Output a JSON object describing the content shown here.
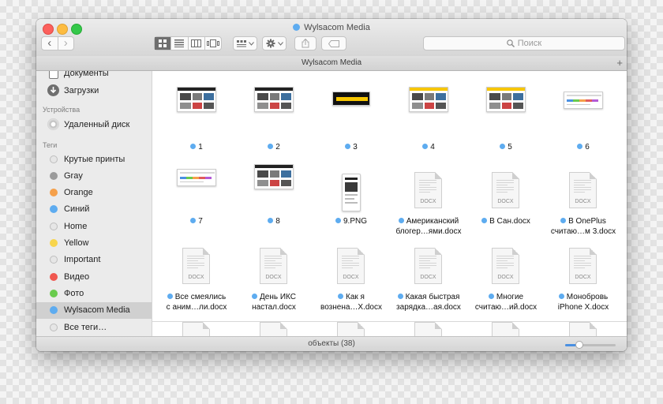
{
  "window": {
    "title": "Wylsacom Media",
    "title_dot_color": "#5eacf0",
    "path_title": "Wylsacom Media"
  },
  "toolbar": {
    "back_icon": "‹",
    "forward_icon": "›",
    "search_placeholder": "Поиск"
  },
  "sidebar": {
    "favorites": [
      {
        "label": "Документы",
        "icon": "documents-icon"
      },
      {
        "label": "Загрузки",
        "icon": "downloads-icon"
      }
    ],
    "devices_header": "Устройства",
    "devices": [
      {
        "label": "Удаленный диск",
        "icon": "remote-disk-icon"
      }
    ],
    "tags_header": "Теги",
    "tags": [
      {
        "label": "Крутые принты",
        "color": "#e6e6e6"
      },
      {
        "label": "Gray",
        "color": "#9b9b9b"
      },
      {
        "label": "Orange",
        "color": "#f5a04a"
      },
      {
        "label": "Синий",
        "color": "#5eacf0"
      },
      {
        "label": "Home",
        "color": "#e6e6e6"
      },
      {
        "label": "Yellow",
        "color": "#f8d54c"
      },
      {
        "label": "Important",
        "color": "#e6e6e6"
      },
      {
        "label": "Видео",
        "color": "#f0574f"
      },
      {
        "label": "Фото",
        "color": "#6acb4e"
      },
      {
        "label": "Wylsacom Media",
        "color": "#5eacf0",
        "selected": true
      },
      {
        "label": "Все теги…",
        "color": "#e6e6e6"
      }
    ]
  },
  "files": [
    {
      "name1": "1",
      "name2": "",
      "kind": "site"
    },
    {
      "name1": "2",
      "name2": "",
      "kind": "site"
    },
    {
      "name1": "3",
      "name2": "",
      "kind": "banner"
    },
    {
      "name1": "4",
      "name2": "",
      "kind": "site-yellow"
    },
    {
      "name1": "5",
      "name2": "",
      "kind": "site-yellow"
    },
    {
      "name1": "6",
      "name2": "",
      "kind": "site-light"
    },
    {
      "name1": "7",
      "name2": "",
      "kind": "site-light"
    },
    {
      "name1": "8",
      "name2": "",
      "kind": "site"
    },
    {
      "name1": "9.PNG",
      "name2": "",
      "kind": "phone"
    },
    {
      "name1": "Американский",
      "name2": "блогер…ями.docx",
      "kind": "docx"
    },
    {
      "name1": "В Сан.docx",
      "name2": "",
      "kind": "docx"
    },
    {
      "name1": "В OnePlus",
      "name2": "считаю…м 3.docx",
      "kind": "docx"
    },
    {
      "name1": "Все смеялись",
      "name2": "с аним…ли.docx",
      "kind": "docx"
    },
    {
      "name1": "День ИКС",
      "name2": "настал.docx",
      "kind": "docx"
    },
    {
      "name1": "Как я",
      "name2": "вознена…X.docx",
      "kind": "docx"
    },
    {
      "name1": "Какая быстрая",
      "name2": "зарядка…ая.docx",
      "kind": "docx"
    },
    {
      "name1": "Многие",
      "name2": "считаю…ий.docx",
      "kind": "docx"
    },
    {
      "name1": "Монобровь",
      "name2": "iPhone X.docx",
      "kind": "docx"
    }
  ],
  "docx_label": "DOCX",
  "status": {
    "text": "объекты (38)",
    "zoom_level": 0.28
  }
}
